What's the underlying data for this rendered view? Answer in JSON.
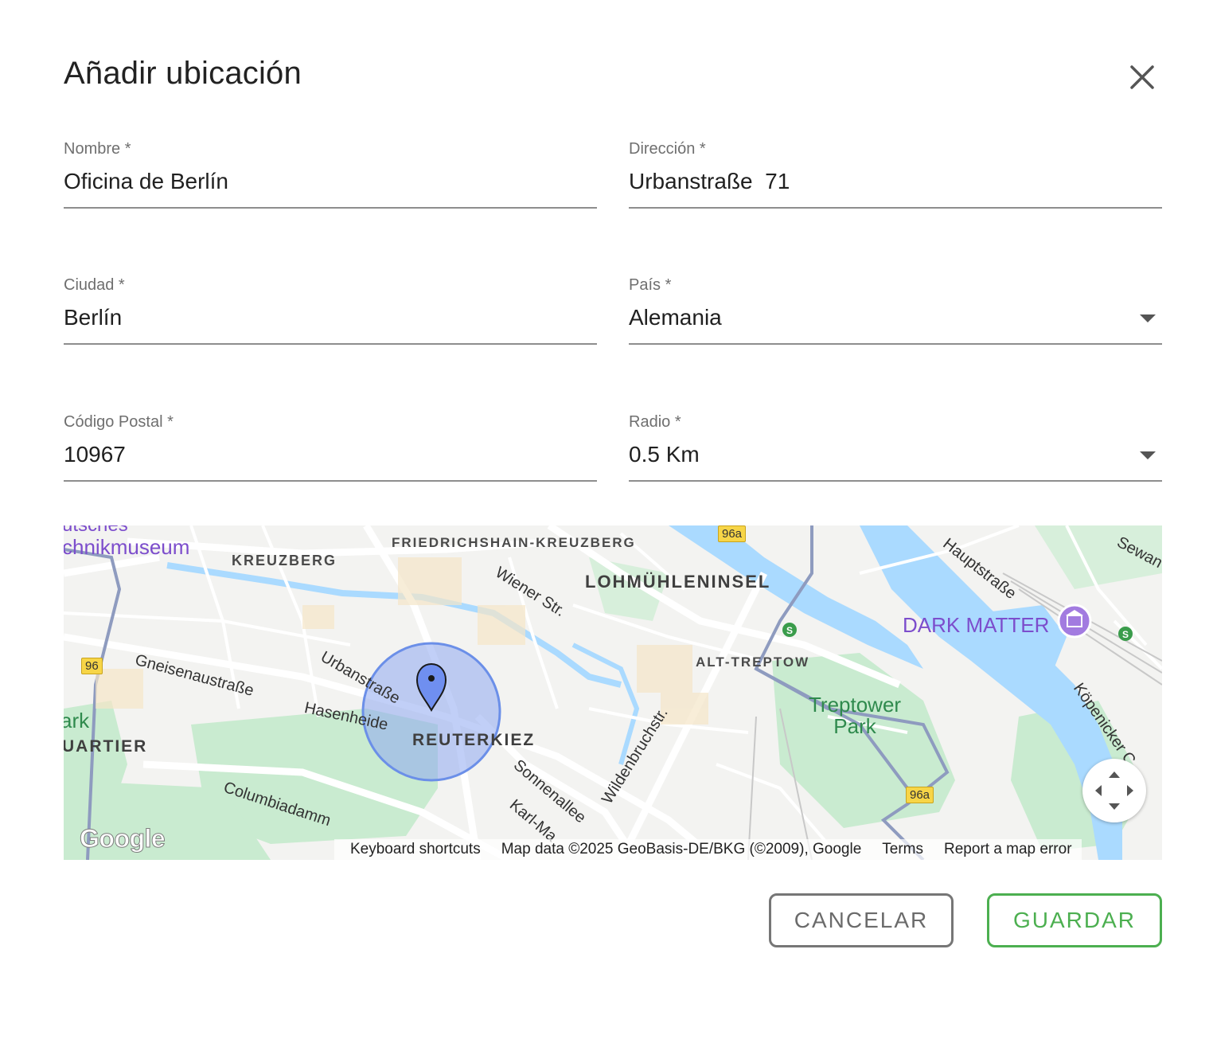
{
  "dialog": {
    "title": "Añadir ubicación"
  },
  "form": {
    "name": {
      "label": "Nombre *",
      "value": "Oficina de Berlín"
    },
    "address": {
      "label": "Dirección *",
      "value": "Urbanstraße  71"
    },
    "city": {
      "label": "Ciudad *",
      "value": "Berlín"
    },
    "country": {
      "label": "País *",
      "value": "Alemania"
    },
    "postal_code": {
      "label": "Código Postal *",
      "value": "10967"
    },
    "radius": {
      "label": "Radio *",
      "value": "0.5 Km"
    }
  },
  "map": {
    "labels": {
      "museum": "chnikmuseum",
      "museum_top": "utsches",
      "kreuzberg": "KREUZBERG",
      "friedrichshain": "FRIEDRICHSHAIN-KREUZBERG",
      "lohmuehleninsel": "LOHMÜHLENINSEL",
      "alt_treptow": "ALT-TREPTOW",
      "reuterkiez": "REUTERKIEZ",
      "quartier": "UARTIER",
      "park_left": "ark",
      "treptower_park": "Treptower\nPark",
      "dark_matter": "DARK MATTER",
      "wiener": "Wiener Str.",
      "gneisenau": "Gneisenaustraße",
      "urbanstrasse": "Urbanstraße",
      "hasenheide": "Hasenheide",
      "columbiadamm": "Columbiadamm",
      "sonnenallee": "Sonnenallee",
      "karl_marx": "Karl-Ma",
      "wildenbruch": "Wildenbruchstr.",
      "hauptstrasse": "Hauptstraße",
      "koepenicker": "Köpenicker C",
      "sewan": "Sewan",
      "shield_96": "96",
      "shield_96a_top": "96a",
      "shield_96a_bottom": "96a"
    },
    "footer": {
      "keyboard": "Keyboard shortcuts",
      "data": "Map data ©2025 GeoBasis-DE/BKG (©2009), Google",
      "terms": "Terms",
      "report": "Report a map error"
    },
    "logo": "Google",
    "colors": {
      "water": "#aadaff",
      "park": "#c9ebd0",
      "radius_fill": "#8ea8f0",
      "radius_stroke": "#6b8fe8",
      "marker": "#6f8ff0"
    }
  },
  "actions": {
    "cancel": "CANCELAR",
    "save": "GUARDAR"
  }
}
